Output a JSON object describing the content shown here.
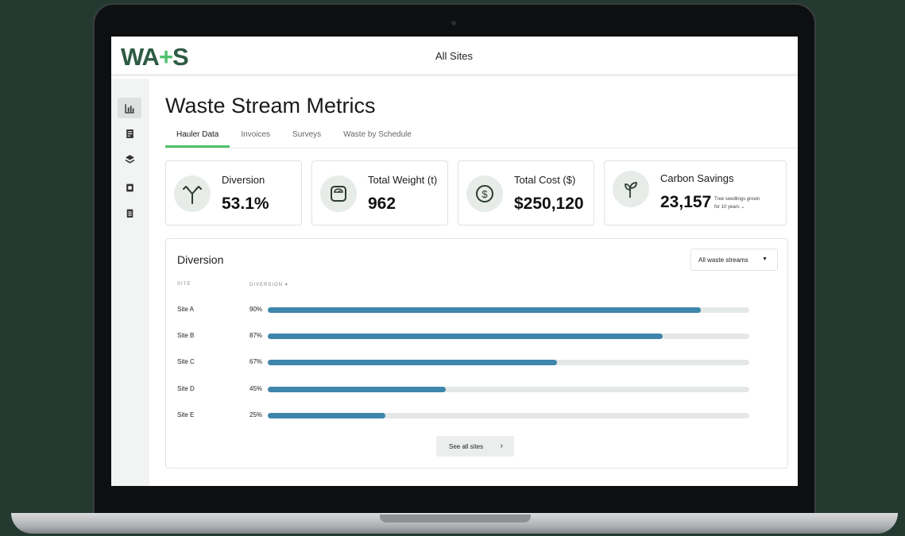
{
  "header": {
    "logo_left": "WA",
    "logo_plus": "+",
    "logo_right": "S",
    "site_selector": "All Sites"
  },
  "sidebar": {
    "items": [
      {
        "icon": "chart-icon",
        "active": true
      },
      {
        "icon": "document-icon",
        "active": false
      },
      {
        "icon": "layers-icon",
        "active": false
      },
      {
        "icon": "file-icon",
        "active": false
      },
      {
        "icon": "clipboard-icon",
        "active": false
      }
    ]
  },
  "page": {
    "title": "Waste Stream Metrics"
  },
  "tabs": [
    {
      "label": "Hauler Data",
      "active": true
    },
    {
      "label": "Invoices",
      "active": false
    },
    {
      "label": "Surveys",
      "active": false
    },
    {
      "label": "Waste by Schedule",
      "active": false
    }
  ],
  "metrics": [
    {
      "label": "Diversion",
      "value": "53.1%",
      "icon": "split-arrows-icon"
    },
    {
      "label": "Total Weight (t)",
      "value": "962",
      "icon": "scale-icon"
    },
    {
      "label": "Total Cost ($)",
      "value": "$250,120",
      "icon": "dollar-icon"
    },
    {
      "label": "Carbon Savings",
      "value": "23,157",
      "icon": "sprout-icon",
      "note_line1": "Tree seedlings grown",
      "note_line2": "for 10 years"
    }
  ],
  "diversion": {
    "title": "Diversion",
    "filter": "All waste streams",
    "columns": {
      "site": "SITE",
      "diversion": "DIVERSION"
    },
    "see_all": "See all sites",
    "rows": [
      {
        "site": "Site A",
        "pct_label": "90%",
        "value": 0.9
      },
      {
        "site": "Site B",
        "pct_label": "87%",
        "value": 0.82
      },
      {
        "site": "Site C",
        "pct_label": "67%",
        "value": 0.6
      },
      {
        "site": "Site D",
        "pct_label": "45%",
        "value": 0.37
      },
      {
        "site": "Site E",
        "pct_label": "25%",
        "value": 0.245
      }
    ]
  },
  "colors": {
    "accent": "#4fc26c",
    "bar": "#3e86ab",
    "brand": "#2e5b44",
    "background": "#243a31"
  }
}
